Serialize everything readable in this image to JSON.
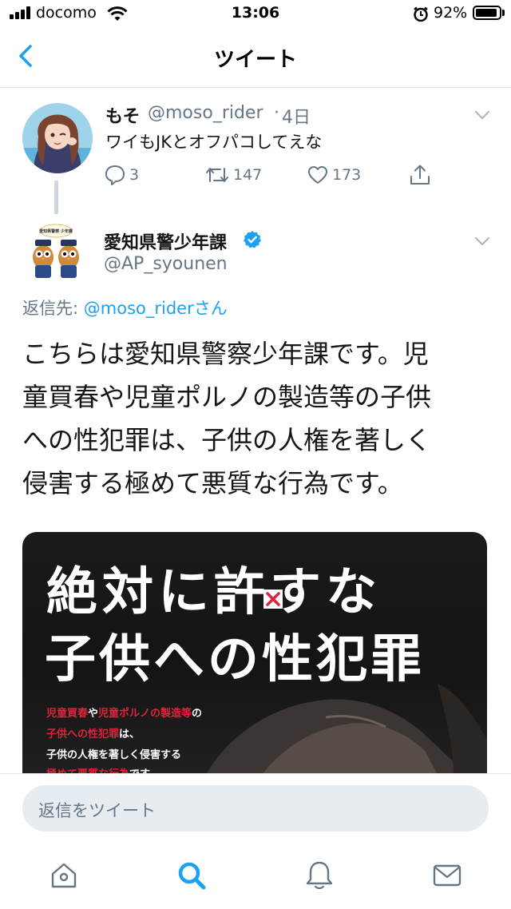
{
  "status_bar": {
    "carrier": "docomo",
    "time": "13:06",
    "battery": "92%",
    "battery_level": 0.92
  },
  "nav": {
    "title": "ツイート"
  },
  "tweet1": {
    "name": "もそ",
    "handle": "@moso_rider",
    "separator": "·",
    "age": "4日",
    "text": "ワイもJKとオフパコしてえな",
    "replies": "3",
    "retweets": "147",
    "likes": "173"
  },
  "tweet2": {
    "name": "愛知県警少年課",
    "handle": "@AP_syounen",
    "avatar_label": "愛知県警察 少年課",
    "replying_label": "返信先: ",
    "replying_to": "@moso_rider",
    "replying_suffix": "さん",
    "text_lines": [
      "こちらは愛知県警察少年課です。児",
      "童買春や児童ポルノの製造等の子供",
      "への性犯罪は、子供の人権を著しく",
      "侵害する極めて悪質な行為です。"
    ]
  },
  "poster": {
    "headline_1": "絶対に許すな",
    "headline_2": "子供への性犯罪",
    "caption_line1_red_a": "児童買春",
    "caption_line1_mid": "や",
    "caption_line1_red_b": "児童ポルノの製造等",
    "caption_line1_end": "の",
    "caption_line2_red": "子供への性犯罪",
    "caption_line2_end": "は、",
    "caption_line3": "子供の人権を著しく侵害する",
    "caption_line4_red": "極めて悪質な行為",
    "caption_line4_end": "です。"
  },
  "reply": {
    "placeholder": "返信をツイート"
  },
  "tabs": [
    "home-icon",
    "search-icon",
    "notifications-icon",
    "messages-icon"
  ],
  "colors": {
    "accent": "#1da1f2",
    "secondary_text": "#657786",
    "poster_red": "#e0233a",
    "divider": "#e1e8ed"
  }
}
